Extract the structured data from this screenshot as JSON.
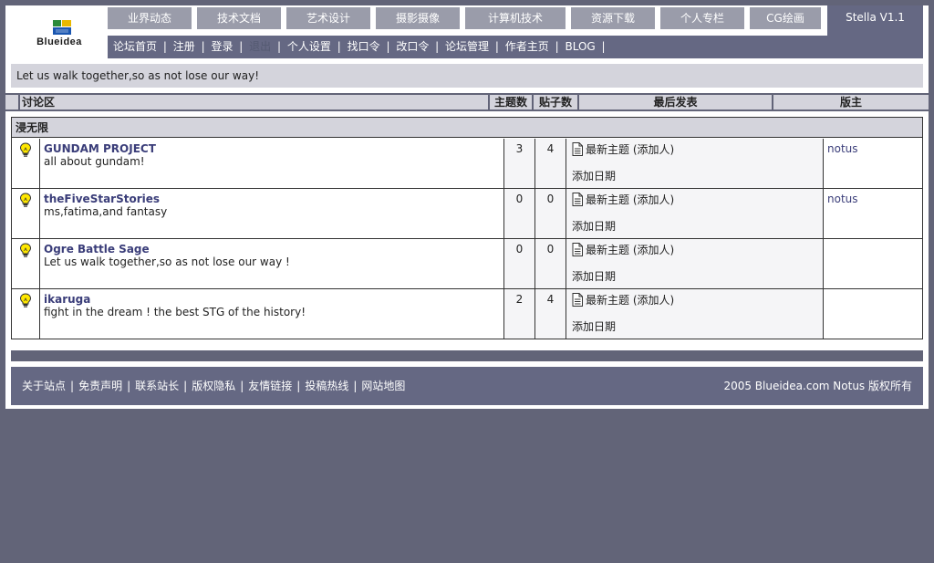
{
  "logo": {
    "text": "Blueidea"
  },
  "top_nav": [
    {
      "label": "业界动态"
    },
    {
      "label": "技术文档"
    },
    {
      "label": "艺术设计"
    },
    {
      "label": "摄影摄像"
    },
    {
      "label": "计算机技术"
    },
    {
      "label": "资源下载"
    },
    {
      "label": "个人专栏"
    },
    {
      "label": "CG绘画"
    }
  ],
  "version": "Stella V1.1",
  "sub_nav": [
    {
      "label": "论坛首页",
      "dim": false
    },
    {
      "label": "注册",
      "dim": false
    },
    {
      "label": "登录",
      "dim": false
    },
    {
      "label": "退出",
      "dim": true
    },
    {
      "label": "个人设置",
      "dim": false
    },
    {
      "label": "找口令",
      "dim": false
    },
    {
      "label": "改口令",
      "dim": false
    },
    {
      "label": "论坛管理",
      "dim": false
    },
    {
      "label": "作者主页",
      "dim": false
    },
    {
      "label": "BLOG",
      "dim": false
    }
  ],
  "notice": "Let us walk together,so as not lose our way!",
  "table_headers": {
    "forum": "讨论区",
    "topics": "主题数",
    "posts": "贴子数",
    "last_post": "最后发表",
    "moderator": "版主"
  },
  "category": "浸无限",
  "forums": [
    {
      "title": "GUNDAM PROJECT",
      "desc": "all about gundam!",
      "topics": "3",
      "posts": "4",
      "last_title": "最新主题 (添加人)",
      "last_date": "添加日期",
      "moderator": "notus"
    },
    {
      "title": "theFiveStarStories",
      "desc": "ms,fatima,and fantasy",
      "topics": "0",
      "posts": "0",
      "last_title": "最新主题 (添加人)",
      "last_date": "添加日期",
      "moderator": "notus"
    },
    {
      "title": "Ogre Battle Sage",
      "desc": "Let us walk together,so as not lose our way !",
      "topics": "0",
      "posts": "0",
      "last_title": "最新主题 (添加人)",
      "last_date": "添加日期",
      "moderator": ""
    },
    {
      "title": "ikaruga",
      "desc": "fight in the dream ! the best STG of the history!",
      "topics": "2",
      "posts": "4",
      "last_title": "最新主题 (添加人)",
      "last_date": "添加日期",
      "moderator": ""
    }
  ],
  "footer": {
    "links": [
      "关于站点",
      "免责声明",
      "联系站长",
      "版权隐私",
      "友情链接",
      "投稿热线",
      "网站地图"
    ],
    "copyright": "2005 Blueidea.com Notus 版权所有"
  },
  "colors": {
    "background": "#626478",
    "nav_tab": "#9a9caa",
    "nav_bar": "#656883",
    "link": "#3a3d79"
  },
  "icons": {
    "row_icon": "lightbulb-icon",
    "last_post_icon": "document-icon"
  }
}
